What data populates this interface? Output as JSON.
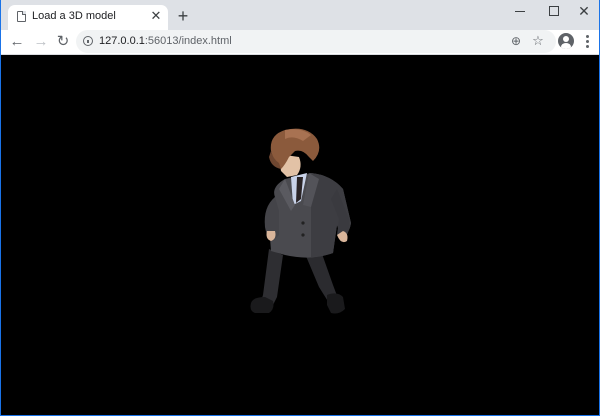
{
  "tab": {
    "title": "Load a 3D model",
    "favicon_icon": "page-icon",
    "close_icon": "close-icon"
  },
  "newtab_icon": "plus-icon",
  "window_controls": {
    "minimize_icon": "minimize-icon",
    "maximize_icon": "maximize-icon",
    "close_icon": "close-icon"
  },
  "toolbar": {
    "back_icon": "arrow-left-icon",
    "forward_icon": "arrow-right-icon",
    "reload_icon": "reload-icon",
    "security_icon": "info-icon",
    "url_host": "127.0.0.1",
    "url_rest": ":56013/index.html",
    "zoom_icon": "zoom-icon",
    "bookmark_icon": "star-icon",
    "profile_icon": "account-icon",
    "menu_icon": "more-vert-icon"
  },
  "viewport": {
    "background": "#000000",
    "content": "3d-character-model"
  },
  "colors": {
    "tabstrip": "#dee1e6",
    "accent": "#1a73e8",
    "suit": "#4a4a4f",
    "hair": "#8b5a3c"
  }
}
